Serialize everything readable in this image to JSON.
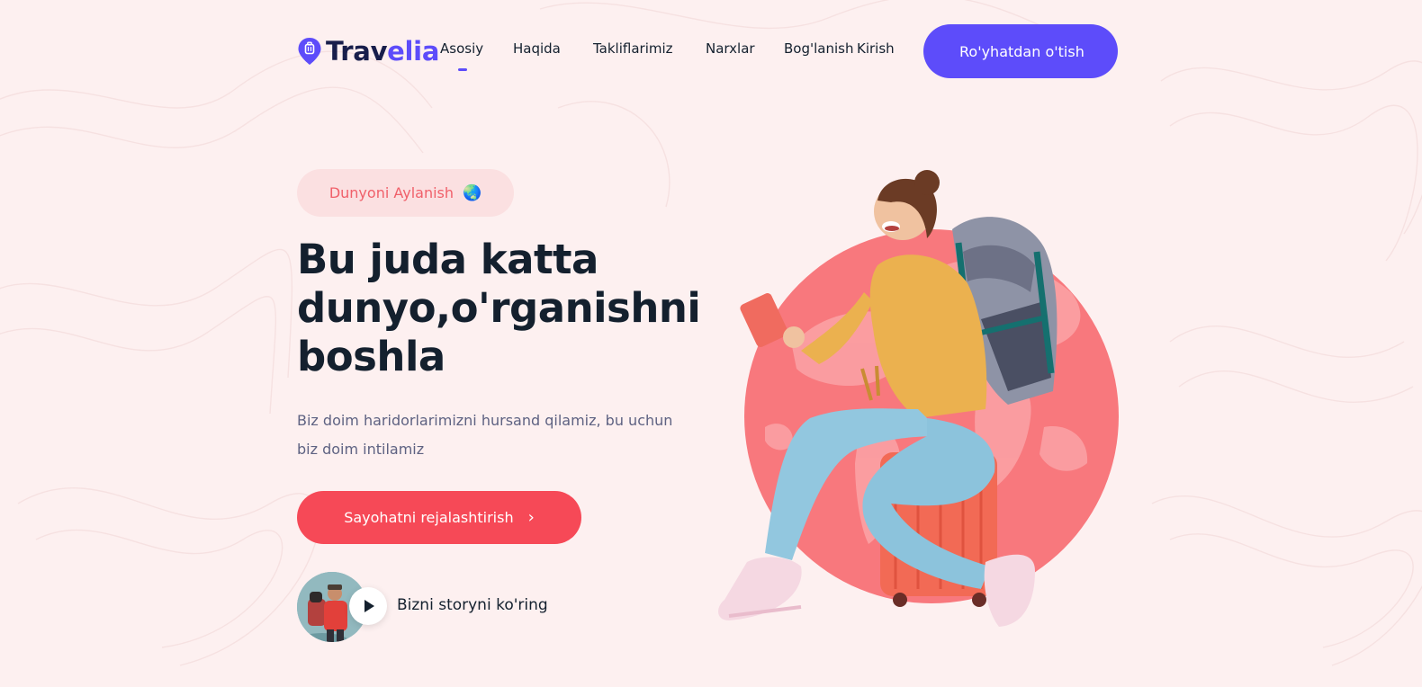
{
  "brand": {
    "name_main": "Trav",
    "name_accent": "elia",
    "accent_color": "#5d4cfa",
    "logo_icon": "luggage-pin-icon"
  },
  "nav": {
    "items": [
      {
        "label": "Asosiy",
        "active": true
      },
      {
        "label": "Haqida",
        "active": false
      },
      {
        "label": "Takliflarimiz",
        "active": false
      },
      {
        "label": "Narxlar",
        "active": false
      },
      {
        "label": "Bog'lanish",
        "active": false
      },
      {
        "label": "Kirish",
        "active": false
      }
    ],
    "register_label": "Ro'yhatdan o'tish"
  },
  "hero": {
    "tagline": "Dunyoni Aylanish",
    "tagline_icon": "globe-icon",
    "tagline_emoji": "🌏",
    "title": "Bu juda katta dunyo,o'rganishni boshla",
    "description": "Biz doim haridorlarimizni hursand qilamiz, bu uchun biz doim intilamiz",
    "cta_label": "Sayohatni rejalashtirish",
    "cta_icon": "chevron-right-icon",
    "story_label": "Bizni storyni ko'ring",
    "play_icon": "play-icon"
  },
  "colors": {
    "background": "#fdf0f0",
    "primary": "#5d4cfa",
    "cta": "#f64957",
    "tagline_bg": "#fbe0e1",
    "tagline_text": "#f0606a",
    "globe": "#f8787d"
  }
}
